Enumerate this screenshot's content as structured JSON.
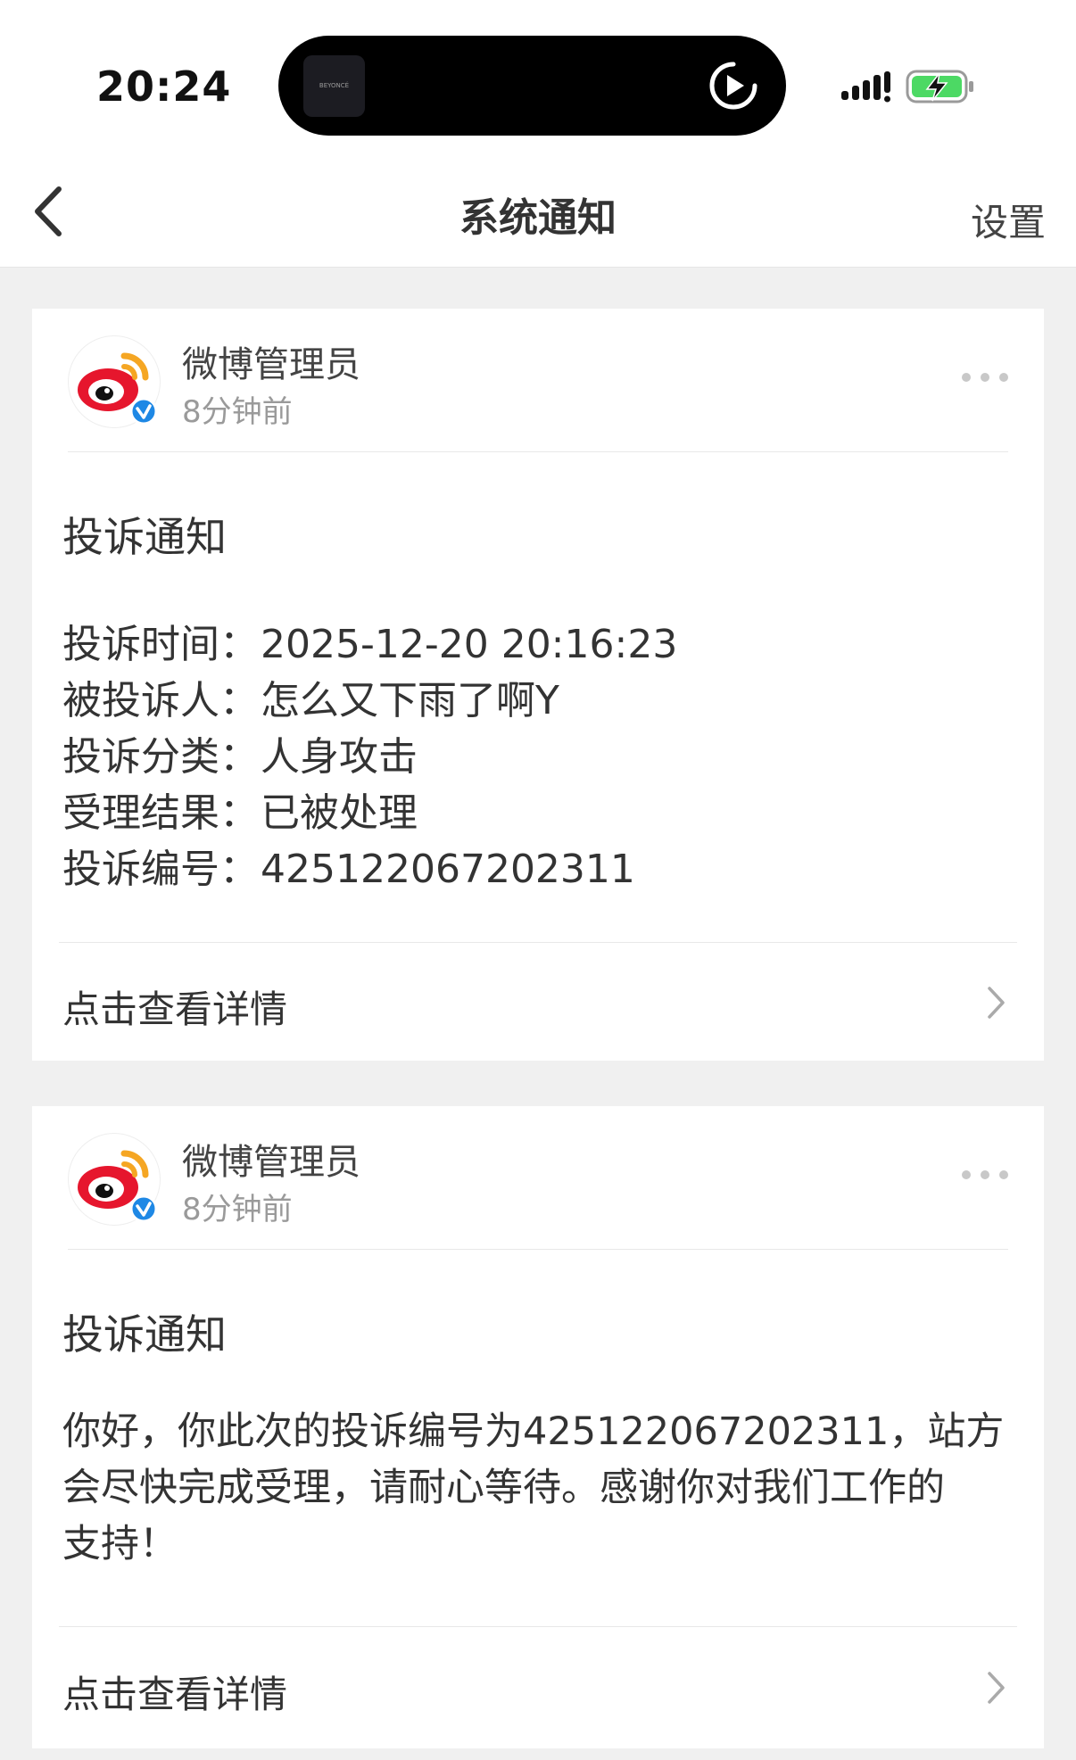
{
  "status_bar": {
    "time": "20:24",
    "now_playing_art_text": "BEYONCÉ",
    "icons": [
      "play-circle-icon",
      "signal-icon",
      "battery-charging-icon"
    ]
  },
  "nav": {
    "back_icon": "chevron-left-icon",
    "title": "系统通知",
    "settings": "设置"
  },
  "colors": {
    "background": "#f0f0f0",
    "card": "#ffffff",
    "weibo_red": "#e6162d",
    "weibo_orange": "#f5a623",
    "verified_blue": "#1e88e5",
    "battery_green": "#4cd964"
  },
  "notifications": [
    {
      "sender": "微博管理员",
      "time": "8分钟前",
      "title": "投诉通知",
      "fields": [
        {
          "label": "投诉时间：",
          "value": "2025-12-20 20:16:23"
        },
        {
          "label": "被投诉人：",
          "value": "怎么又下雨了啊Y"
        },
        {
          "label": "投诉分类：",
          "value": "人身攻击"
        },
        {
          "label": "受理结果：",
          "value": "已被处理"
        },
        {
          "label": "投诉编号：",
          "value": "425122067202311"
        }
      ],
      "link": "点击查看详情"
    },
    {
      "sender": "微博管理员",
      "time": "8分钟前",
      "title": "投诉通知",
      "body_lines": [
        "你好，你此次的投诉编号为425122067202311，站方",
        "会尽快完成受理，请耐心等待。感谢你对我们工作的",
        "支持！"
      ],
      "link": "点击查看详情"
    }
  ]
}
